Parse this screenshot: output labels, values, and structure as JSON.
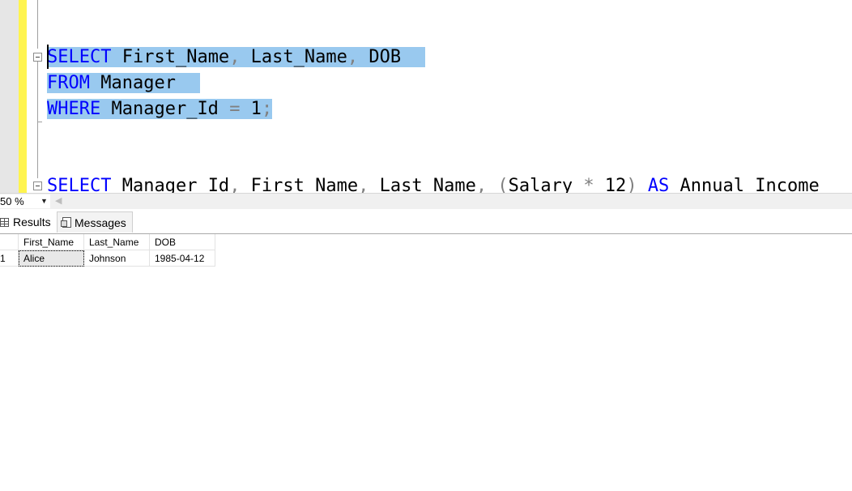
{
  "editor": {
    "lines": {
      "l1": {
        "kw1": "SELECT",
        "t1": " First_Name",
        "p1": ",",
        "t2": " Last_Name",
        "p2": ",",
        "t3": " DOB"
      },
      "l2": {
        "kw1": "FROM",
        "t1": " Manager"
      },
      "l3": {
        "kw1": "WHERE",
        "t1": " Manager_Id ",
        "op": "=",
        "t2": " 1",
        "semi": ";"
      },
      "l4": {
        "kw1": "SELECT",
        "t1": " Manager_Id",
        "p1": ",",
        "t2": " First_Name",
        "p2": ",",
        "t3": " Last_Name",
        "p3": ",",
        "t4": " ",
        "paren_open": "(",
        "t5": "Salary ",
        "op": "*",
        "t6": " 12",
        "paren_close": ")",
        "t7": " ",
        "kw2": "AS",
        "t8": " Annual_Income"
      }
    }
  },
  "zoom": {
    "value": "50 %"
  },
  "tabs": {
    "results": "Results",
    "messages": "Messages"
  },
  "results": {
    "columns": [
      "First_Name",
      "Last_Name",
      "DOB"
    ],
    "rows": [
      {
        "num": "1",
        "cells": [
          "Alice",
          "Johnson",
          "1985-04-12"
        ]
      }
    ]
  },
  "colors": {
    "selection": "#99c9ef",
    "keyword": "#0000ff",
    "change_bar": "#fff44f"
  }
}
